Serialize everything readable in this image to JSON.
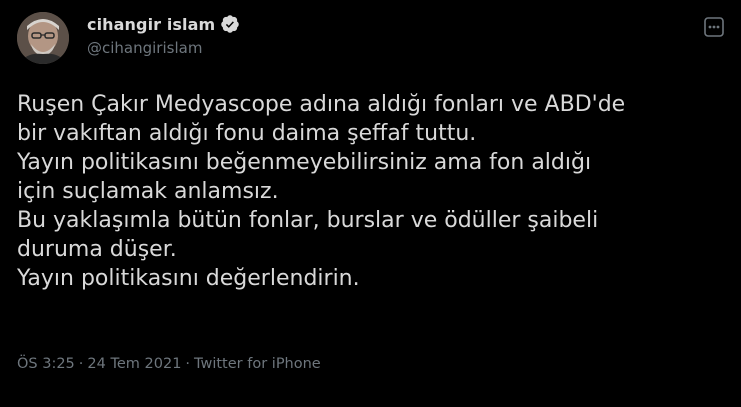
{
  "author": {
    "display_name": "cihangir islam",
    "handle": "@cihangirislam",
    "verified": true,
    "avatar_icon": "profile-photo"
  },
  "tweet": {
    "lines": [
      "Ruşen Çakır Medyascope adına aldığı fonları ve ABD'de",
      "bir vakıftan aldığı fonu daima şeffaf tuttu.",
      "Yayın politikasını beğenmeyebilirsiniz ama fon aldığı",
      "için suçlamak anlamsız.",
      "Bu yaklaşımla bütün fonlar, burslar ve ödüller şaibeli",
      "duruma düşer.",
      "Yayın politikasını değerlendirin."
    ]
  },
  "meta": {
    "time": "ÖS 3:25",
    "separator": "·",
    "date": "24 Tem 2021",
    "source": "Twitter for iPhone"
  },
  "icons": {
    "verified": "verified-badge-icon",
    "more": "more-options-icon"
  },
  "colors": {
    "background": "#000000",
    "text": "#d9d9d9",
    "secondary": "#6e767d"
  }
}
